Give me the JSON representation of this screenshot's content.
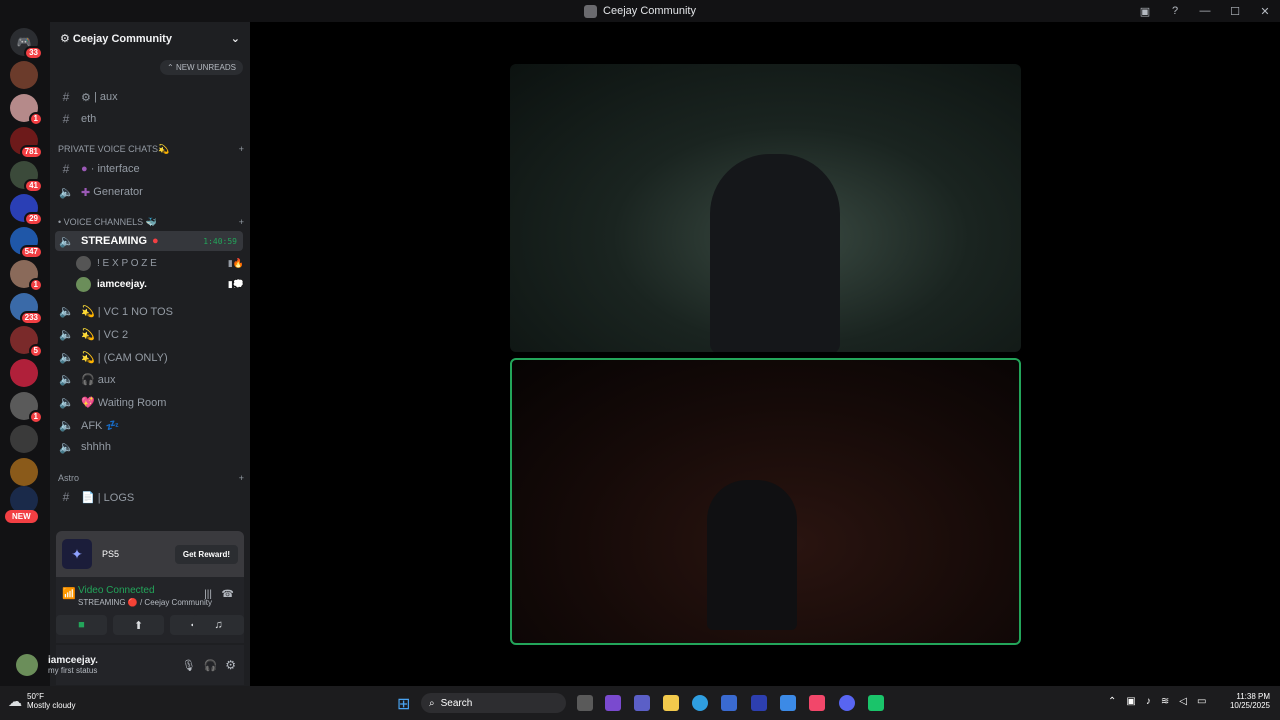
{
  "window": {
    "title": "Ceejay Community"
  },
  "servers": {
    "home_badge": "33",
    "badges": [
      "1",
      "781",
      "41",
      "29",
      "547",
      "1",
      "233",
      "5",
      "1"
    ],
    "new_label": "NEW"
  },
  "sidebar": {
    "server_name": "Ceejay Community",
    "new_unreads": "NEW UNREADS",
    "channels_top": [
      {
        "label": "| aux",
        "emoji": "⚙",
        "icon": "hash-icon"
      },
      {
        "label": "eth",
        "emoji": "",
        "icon": "hash-icon"
      }
    ],
    "cat_private": "PRIVATE VOICE CHATS💫",
    "private_channels": [
      {
        "label": "· interface",
        "icon": "hash-icon"
      },
      {
        "label": "Generator",
        "icon": "speaker-icon"
      }
    ],
    "cat_voice": "• VOICE CHANNELS 🐳",
    "streaming": {
      "label": "STREAMING",
      "time": "1:40:59"
    },
    "users": [
      {
        "name": "! E X P O Z E"
      },
      {
        "name": "iamceejay."
      }
    ],
    "voice_channels": [
      "💫 | VC 1 NO TOS",
      "💫 | VC 2",
      "💫 | (CAM ONLY)",
      "🎧 aux",
      "💖 Waiting Room",
      "AFK 💤",
      "shhhh"
    ],
    "cat_astro": "Astro",
    "logs": "📄 | LOGS"
  },
  "promo": {
    "text": "PS5",
    "button": "Get Reward!"
  },
  "voice_panel": {
    "status": "Video Connected",
    "channel": "STREAMING 🔴 / Ceejay Community"
  },
  "user_panel": {
    "name": "iamceejay.",
    "status": "my first status"
  },
  "taskbar": {
    "weather_temp": "50°F",
    "weather_desc": "Mostly cloudy",
    "search": "Search",
    "time": "11:38 PM",
    "date": "10/25/2025"
  }
}
